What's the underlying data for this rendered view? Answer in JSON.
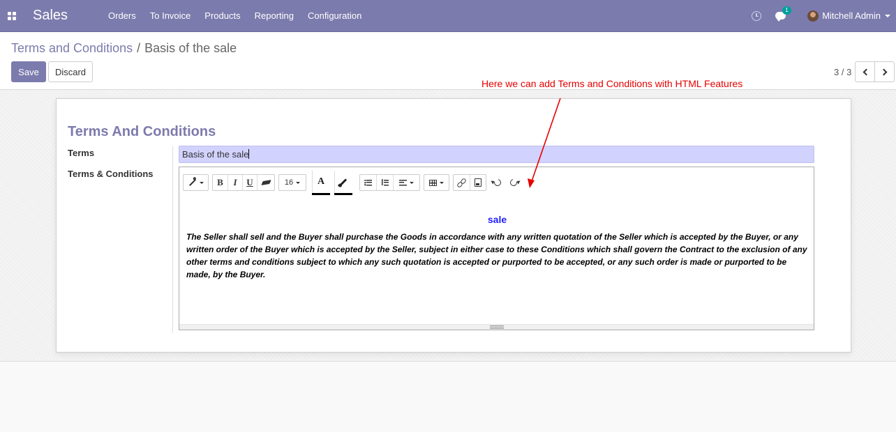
{
  "navbar": {
    "app_title": "Sales",
    "menu": [
      "Orders",
      "To Invoice",
      "Products",
      "Reporting",
      "Configuration"
    ],
    "chat_badge": "1",
    "user_name": "Mitchell Admin",
    "icons": [
      "apps-grid-icon",
      "clock-icon",
      "chat-icon",
      "avatar",
      "caret-down-icon"
    ]
  },
  "breadcrumb": {
    "parent": "Terms and Conditions",
    "separator": "/",
    "current": "Basis of the sale"
  },
  "actions": {
    "save": "Save",
    "discard": "Discard"
  },
  "pager": {
    "value": "3 / 3"
  },
  "form": {
    "title": "Terms And Conditions",
    "terms_label": "Terms",
    "terms_value": "Basis of the sale",
    "tc_label": "Terms & Conditions"
  },
  "editor": {
    "toolbar": {
      "bold": "B",
      "italic": "I",
      "underline": "U",
      "font_size": "16",
      "font_color": "A"
    },
    "heading": "sale",
    "body": "The Seller shall sell and the Buyer shall purchase the Goods in accordance with any written quotation of the Seller which is accepted by the Buyer, or any written order of the Buyer which is accepted by the Seller, subject in either case to these Conditions which shall govern the Contract to the exclusion of any other terms and conditions subject to which any such quotation is accepted or purported to be accepted, or any such order is made or purported to be made, by the Buyer.",
    "heading_color": "#1f1fff"
  },
  "annotation": {
    "text": "Here we can add Terms and Conditions with HTML Features",
    "color": "#e60000"
  },
  "colors": {
    "brand": "#7c7bad",
    "terms_input_bg": "#d2d2ff"
  }
}
